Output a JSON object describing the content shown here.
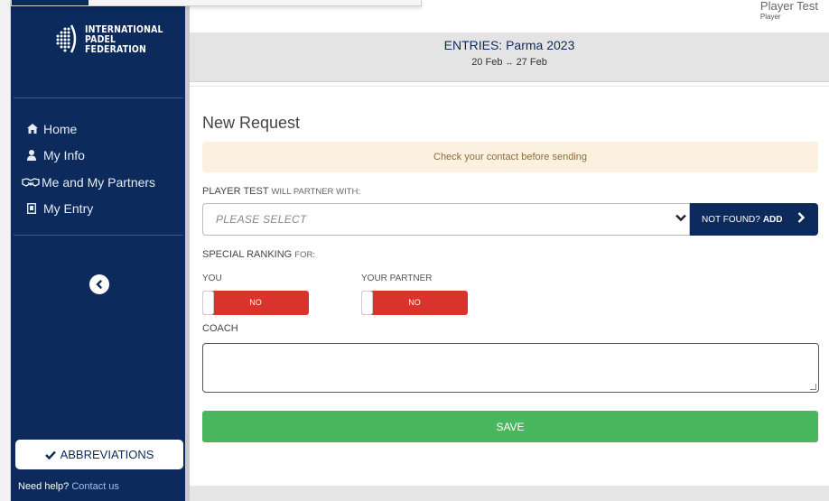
{
  "user": {
    "name": "Player Test",
    "role": "Player"
  },
  "sidebar": {
    "logo_lines": [
      "INTERNATIONAL",
      "PADEL",
      "FEDERATION"
    ],
    "items": [
      {
        "label": "Home",
        "icon": "home-icon"
      },
      {
        "label": "My Info",
        "icon": "user-icon"
      },
      {
        "label": "Me and My Partners",
        "icon": "handshake-icon"
      },
      {
        "label": "My Entry",
        "icon": "entry-icon"
      }
    ],
    "abbreviations_label": "ABBREVIATIONS",
    "help_text": "Need help?",
    "help_link": "Contact us"
  },
  "header": {
    "entries_label": "ENTRIES:",
    "event_name": "Parma 2023",
    "date_start": "20 Feb",
    "date_end": "27 Feb"
  },
  "form": {
    "title": "New Request",
    "notice": "Check your contact before sending",
    "partner_label": "PLAYER TEST",
    "partner_label_suffix": "WILL PARTNER WITH:",
    "partner_placeholder": "PLEASE SELECT",
    "not_found_label": "NOT FOUND?",
    "add_label": "ADD",
    "special_ranking_label": "SPECIAL RANKING",
    "special_ranking_suffix": "FOR:",
    "you_label": "YOU",
    "partner_toggle_label": "YOUR PARTNER",
    "you_toggle_value": "NO",
    "partner_toggle_value": "NO",
    "coach_label": "COACH",
    "coach_value": "",
    "save_label": "SAVE"
  },
  "colors": {
    "navy": "#0c2a5b",
    "save_green": "#4ab75f",
    "toggle_red": "#d9342b",
    "notice_bg": "#fcf1e1"
  }
}
